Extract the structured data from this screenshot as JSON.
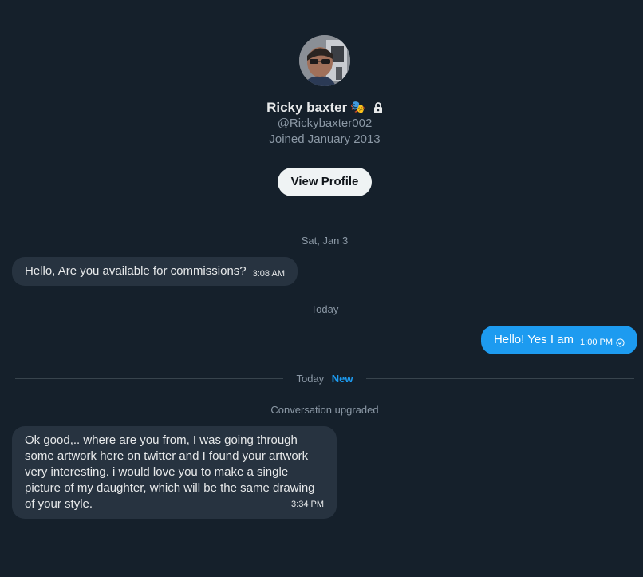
{
  "profile": {
    "name": "Ricky baxter",
    "emoji": "🎭",
    "handle": "@Rickybaxter002",
    "joined": "Joined January 2013",
    "view_profile_label": "View Profile"
  },
  "messages": {
    "date1": "Sat, Jan 3",
    "msg1": {
      "text": "Hello, Are you available for commissions?",
      "time": "3:08 AM"
    },
    "date2": "Today",
    "msg2": {
      "text": "Hello! Yes I am",
      "time": "1:00 PM"
    },
    "divider": {
      "label": "Today",
      "badge": "New"
    },
    "system_note": "Conversation upgraded",
    "msg3": {
      "text": "Ok good,.. where are you from, I was going through some artwork here on twitter and I found your artwork very interesting. i would love you to make a single picture of my daughter, which will be the same drawing of your style.",
      "time": "3:34 PM"
    }
  },
  "colors": {
    "background": "#15202b",
    "incoming_bubble": "#273340",
    "outgoing_bubble": "#1d9bf0",
    "accent": "#1d9bf0"
  },
  "icons": {
    "lock": "lock-icon",
    "sent_check": "sent-check-icon"
  }
}
